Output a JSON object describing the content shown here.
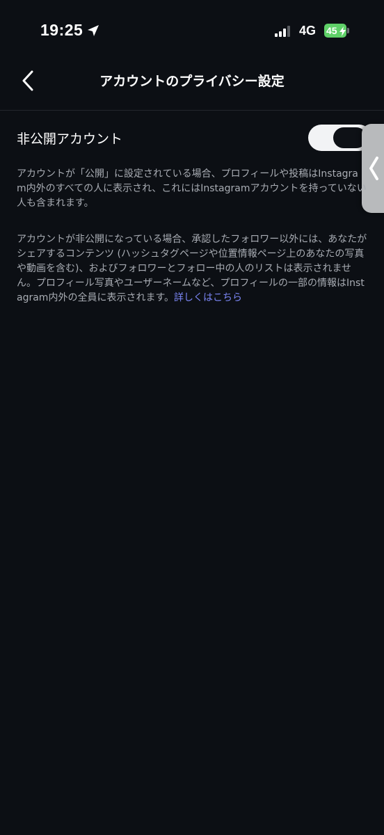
{
  "status_bar": {
    "time": "19:25",
    "network": "4G",
    "battery_level": "45",
    "battery_color": "#5fd068"
  },
  "header": {
    "title": "アカウントのプライバシー設定",
    "back_icon": "chevron-left-icon"
  },
  "private_account": {
    "label": "非公開アカウント",
    "enabled": false
  },
  "descriptions": {
    "public_text": "アカウントが「公開」に設定されている場合、プロフィールや投稿はInstagram内外のすべての人に表示され、これにはInstagramアカウントを持っていない人も含まれます。",
    "private_text": "アカウントが非公開になっている場合、承認したフォロワー以外には、あなたがシェアするコンテンツ (ハッシュタグページや位置情報ページ上のあなたの写真や動画を含む)、およびフォロワーとフォロー中の人のリストは表示されません。プロフィール写真やユーザーネームなど、プロフィールの一部の情報はInstagram内外の全員に表示されます。",
    "learn_more": "詳しくはこちら"
  },
  "colors": {
    "background": "#0c0f14",
    "link": "#7b86f5",
    "secondary_text": "#a8acb3"
  }
}
